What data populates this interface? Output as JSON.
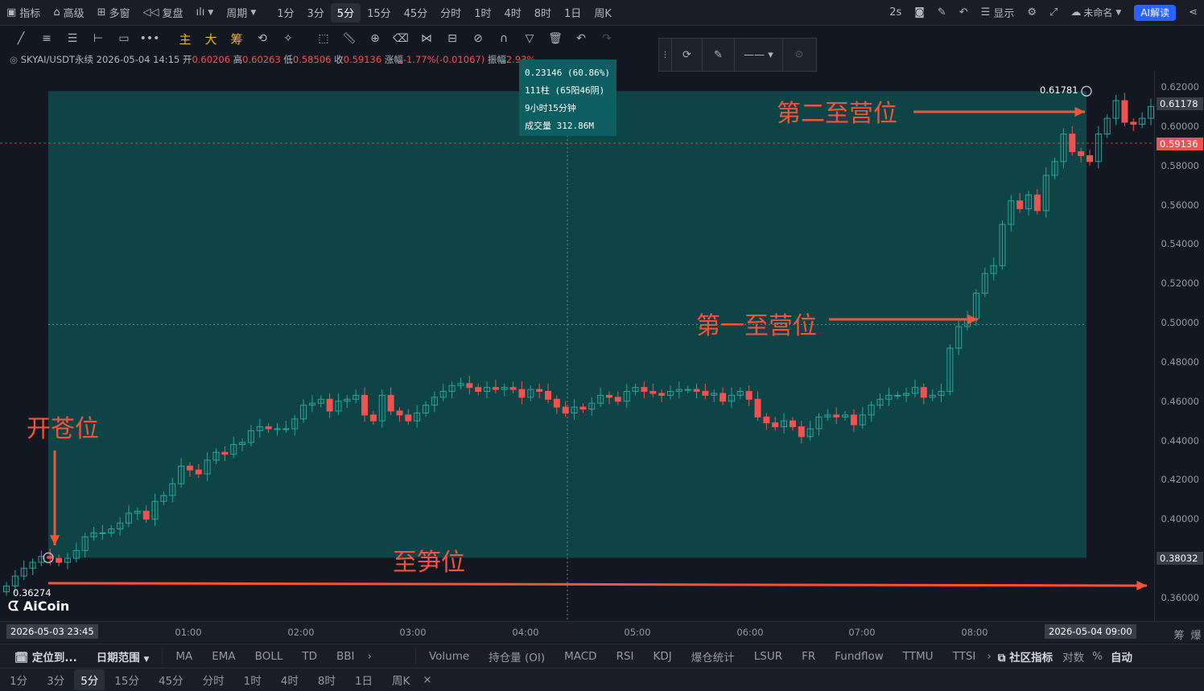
{
  "topbar": {
    "items": [
      "指标",
      "高级",
      "多窗",
      "复盘",
      "ılı",
      "周期"
    ],
    "intervals": [
      "1分",
      "3分",
      "5分",
      "15分",
      "45分",
      "分时",
      "1时",
      "4时",
      "8时",
      "1日",
      "周K"
    ],
    "active_interval": "5分",
    "right": {
      "refresh": "2s",
      "display": "显示",
      "layout_name": "未命名",
      "ai_button": "AI解读"
    }
  },
  "toolbar": {
    "main": "主",
    "big": "大",
    "chips": "筹"
  },
  "legend": {
    "symbol": "SKYAI/USDT永续",
    "datetime": "2026-05-04 14:15",
    "open_label": "开",
    "open": "0.60206",
    "high_label": "高",
    "high": "0.60263",
    "low_label": "低",
    "low": "0.58506",
    "close_label": "收",
    "close": "0.59136",
    "change_label": "涨幅",
    "change": "-1.77%(-0.01067)",
    "amp_label": "振幅",
    "amp": "2.93%"
  },
  "tooltip": {
    "line1": "0.23146 (60.86%)",
    "line2": "111柱 (65阳46阴)",
    "line3": "9小时15分钟",
    "line4": "成交量 312.86M"
  },
  "annotations": {
    "open_position": "开苍位",
    "stop_loss": "至笋位",
    "tp1": "第一至营位",
    "tp2": "第二至营位"
  },
  "measure": {
    "start_price": "0.36274",
    "end_price": "0.61781"
  },
  "price_axis": {
    "labels": [
      "0.62000",
      "0.60000",
      "0.58000",
      "0.56000",
      "0.54000",
      "0.52000",
      "0.50000",
      "0.48000",
      "0.46000",
      "0.44000",
      "0.42000",
      "0.40000",
      "0.36000"
    ],
    "tag_target": "0.61178",
    "tag_current": "0.59136",
    "tag_low": "0.38032"
  },
  "time_axis": {
    "start_badge": "2026-05-03 23:45",
    "labels": [
      "01:00",
      "02:00",
      "03:00",
      "04:00",
      "05:00",
      "06:00",
      "07:00",
      "08:00"
    ],
    "end_badge": "2026-05-04 09:00",
    "right_icons": [
      "筹",
      "爆"
    ]
  },
  "bottom_bar1": {
    "locate": "定位到...",
    "date_range": "日期范围",
    "indicators_main": [
      "MA",
      "EMA",
      "BOLL",
      "TD",
      "BBI"
    ],
    "indicators_sub": [
      "Volume",
      "持仓量 (OI)",
      "MACD",
      "RSI",
      "KDJ",
      "爆仓统计",
      "LSUR",
      "FR",
      "Fundflow",
      "TTMU",
      "TTSI"
    ],
    "community": "社区指标",
    "log": "对数",
    "pct": "%",
    "auto": "自动"
  },
  "bottom_bar2": {
    "intervals": [
      "1分",
      "3分",
      "5分",
      "15分",
      "45分",
      "分时",
      "1时",
      "4时",
      "8时",
      "1日",
      "周K"
    ],
    "active": "5分"
  },
  "colors": {
    "up": "#26a69a",
    "down": "#ef5350",
    "annotation": "#f0553c",
    "zone": "#0f4c4e",
    "background": "#131722"
  },
  "chart_data": {
    "type": "candlestick",
    "symbol": "SKYAI/USDT永续",
    "interval": "5分",
    "ylim": [
      0.35,
      0.625
    ],
    "x_ticks": [
      "01:00",
      "02:00",
      "03:00",
      "04:00",
      "05:00",
      "06:00",
      "07:00",
      "08:00"
    ],
    "bar_count_visible": 111,
    "closes": [
      0.366,
      0.371,
      0.375,
      0.378,
      0.381,
      0.38,
      0.378,
      0.38,
      0.384,
      0.391,
      0.393,
      0.393,
      0.395,
      0.398,
      0.403,
      0.404,
      0.4,
      0.409,
      0.412,
      0.418,
      0.427,
      0.425,
      0.423,
      0.43,
      0.434,
      0.433,
      0.438,
      0.439,
      0.445,
      0.447,
      0.446,
      0.446,
      0.446,
      0.451,
      0.458,
      0.459,
      0.461,
      0.455,
      0.46,
      0.461,
      0.463,
      0.453,
      0.45,
      0.463,
      0.455,
      0.453,
      0.45,
      0.454,
      0.458,
      0.462,
      0.465,
      0.468,
      0.469,
      0.467,
      0.465,
      0.467,
      0.466,
      0.467,
      0.466,
      0.462,
      0.466,
      0.465,
      0.461,
      0.457,
      0.454,
      0.457,
      0.456,
      0.459,
      0.463,
      0.462,
      0.46,
      0.465,
      0.467,
      0.465,
      0.464,
      0.463,
      0.465,
      0.466,
      0.466,
      0.465,
      0.463,
      0.464,
      0.46,
      0.463,
      0.465,
      0.461,
      0.452,
      0.449,
      0.447,
      0.45,
      0.447,
      0.442,
      0.446,
      0.452,
      0.453,
      0.452,
      0.453,
      0.448,
      0.453,
      0.458,
      0.461,
      0.463,
      0.463,
      0.464,
      0.467,
      0.462,
      0.463,
      0.465,
      0.487,
      0.498,
      0.502,
      0.515,
      0.525,
      0.529,
      0.55,
      0.562,
      0.558,
      0.565,
      0.557,
      0.575,
      0.582,
      0.596,
      0.587,
      0.585,
      0.582,
      0.596,
      0.604,
      0.613,
      0.602,
      0.601,
      0.604,
      0.61
    ],
    "reference_lines": {
      "current_price": 0.59136,
      "measure_low": 0.38032,
      "measure_high": 0.61781
    },
    "measure_result": {
      "change": "0.23146 (60.86%)",
      "bars": "111柱 (65阳46阴)",
      "duration": "9小时15分钟",
      "volume": "312.86M"
    }
  }
}
